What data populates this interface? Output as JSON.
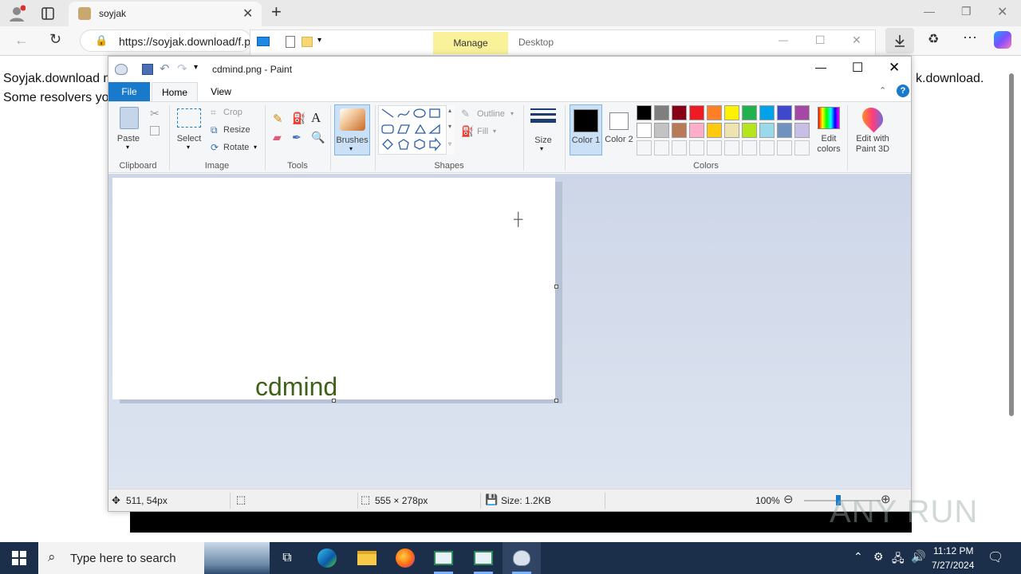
{
  "browser": {
    "tab_title": "soyjak",
    "url": "https://soyjak.download/f.p",
    "page_line1_left": "Soyjak.download m",
    "page_line2_left": "Some resolvers yo",
    "page_line1_right": "k.download."
  },
  "explorer": {
    "manage_label": "Manage",
    "desktop_label": "Desktop"
  },
  "paint": {
    "title": "cdmind.png - Paint",
    "tabs": {
      "file": "File",
      "home": "Home",
      "view": "View"
    },
    "clipboard": {
      "paste": "Paste",
      "group": "Clipboard"
    },
    "image": {
      "select": "Select",
      "crop": "Crop",
      "resize": "Resize",
      "rotate": "Rotate",
      "group": "Image"
    },
    "tools": {
      "group": "Tools"
    },
    "brushes": {
      "label": "Brushes"
    },
    "shapes": {
      "outline": "Outline",
      "fill": "Fill",
      "group": "Shapes"
    },
    "size": {
      "label": "Size"
    },
    "colors": {
      "color1": "Color 1",
      "color2": "Color 2",
      "edit_colors": "Edit colors",
      "edit_paint3d": "Edit with Paint 3D",
      "group": "Colors",
      "color1_value": "#000000",
      "color2_value": "#ffffff",
      "palette_row1": [
        "#000000",
        "#7f7f7f",
        "#880015",
        "#ed1c24",
        "#ff7f27",
        "#fff200",
        "#22b14c",
        "#00a2e8",
        "#3f48cc",
        "#a349a4"
      ],
      "palette_row2": [
        "#ffffff",
        "#c3c3c3",
        "#b97a57",
        "#ffaec9",
        "#ffc90e",
        "#efe4b0",
        "#b5e61d",
        "#99d9ea",
        "#7092be",
        "#c8bfe7"
      ]
    },
    "canvas_text": "cdmind",
    "canvas_text_color": "#3f6119",
    "status": {
      "cursor_pos": "511, 54px",
      "image_size": "555 × 278px",
      "file_size": "Size: 1.2KB",
      "zoom": "100%"
    }
  },
  "taskbar": {
    "search_placeholder": "Type here to search",
    "time": "11:12 PM",
    "date": "7/27/2024"
  },
  "watermark": "ANY RUN"
}
